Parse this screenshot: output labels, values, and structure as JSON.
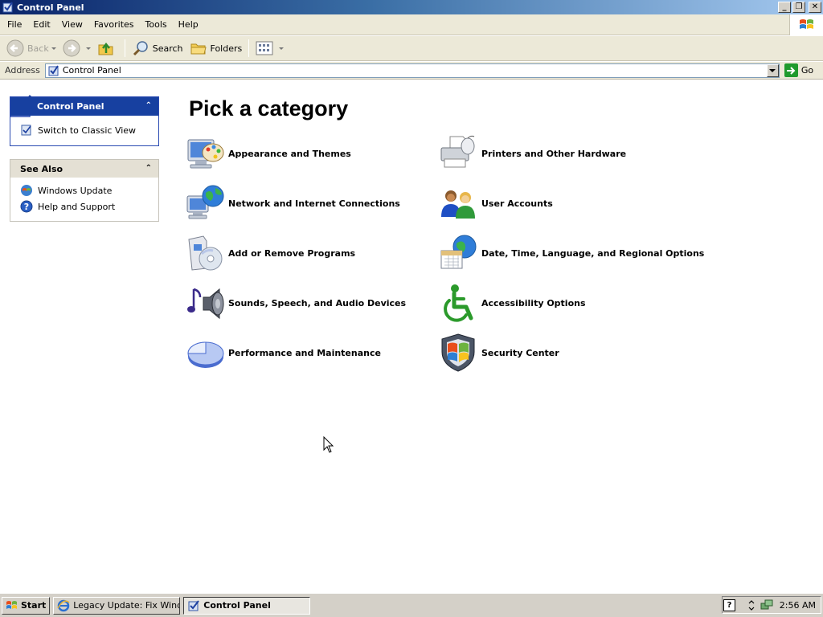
{
  "window": {
    "title": "Control Panel"
  },
  "menu": [
    "File",
    "Edit",
    "View",
    "Favorites",
    "Tools",
    "Help"
  ],
  "toolbar": {
    "back_label": "Back",
    "search_label": "Search",
    "folders_label": "Folders"
  },
  "address": {
    "label": "Address",
    "value": "Control Panel",
    "go_label": "Go"
  },
  "left": {
    "cp_title": "Control Panel",
    "switch_label": "Switch to Classic View",
    "see_also_title": "See Also",
    "see_also": [
      "Windows Update",
      "Help and Support"
    ]
  },
  "main": {
    "heading": "Pick a category",
    "categories": [
      {
        "label": "Appearance and Themes",
        "icon": "appearance-themes-icon"
      },
      {
        "label": "Printers and Other Hardware",
        "icon": "printer-icon"
      },
      {
        "label": "Network and Internet Connections",
        "icon": "network-globe-icon"
      },
      {
        "label": "User Accounts",
        "icon": "user-accounts-icon"
      },
      {
        "label": "Add or Remove Programs",
        "icon": "add-remove-programs-icon"
      },
      {
        "label": "Date, Time, Language, and Regional Options",
        "icon": "date-time-globe-icon"
      },
      {
        "label": "Sounds, Speech, and Audio Devices",
        "icon": "speaker-music-icon"
      },
      {
        "label": "Accessibility Options",
        "icon": "accessibility-icon"
      },
      {
        "label": "Performance and Maintenance",
        "icon": "pie-chart-icon"
      },
      {
        "label": "Security Center",
        "icon": "security-shield-icon"
      }
    ]
  },
  "taskbar": {
    "start_label": "Start",
    "tasks": [
      "Legacy Update: Fix Wind...",
      "Control Panel"
    ],
    "clock": "2:56 AM"
  },
  "colors": {
    "title_bar": "#0a246a",
    "task_header": "#1740a0",
    "accent_green": "#1f9a2d"
  }
}
